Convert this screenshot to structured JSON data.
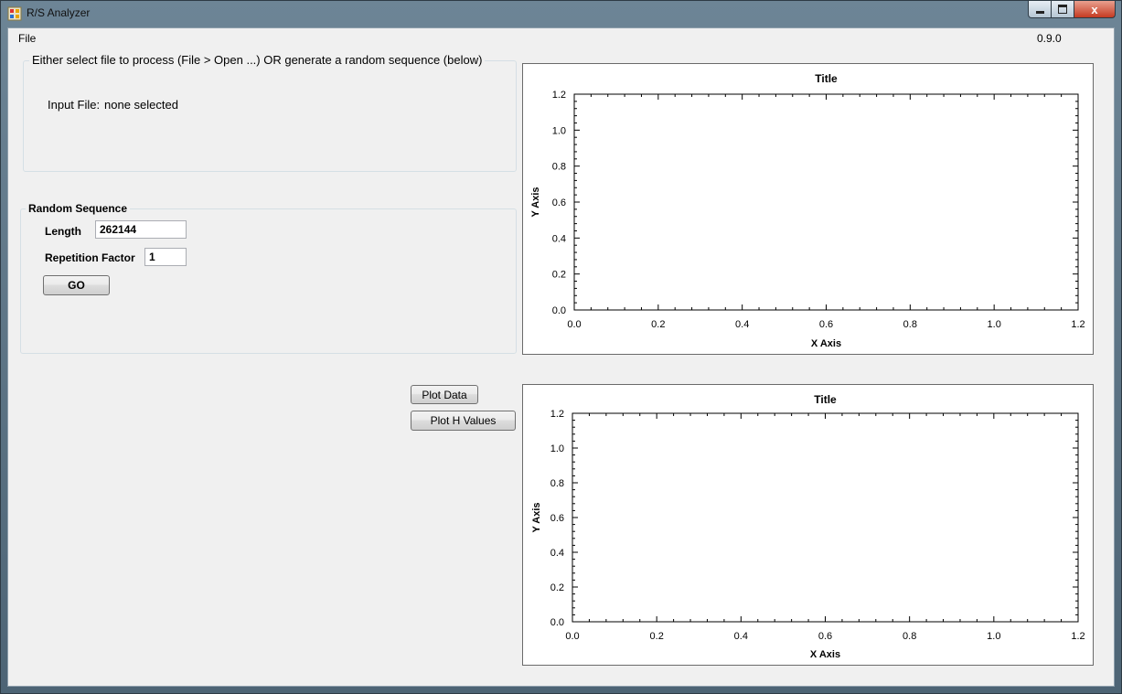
{
  "window": {
    "title": "R/S Analyzer",
    "close_glyph": "x"
  },
  "menu": {
    "file_label": "File",
    "version": "0.9.0"
  },
  "input_group": {
    "caption": "Either select file to process (File > Open ...) OR generate a random sequence (below)",
    "input_file_label": "Input File:",
    "input_file_value": "none selected"
  },
  "random_group": {
    "caption": "Random Sequence",
    "length_label": "Length",
    "length_value": "262144",
    "repetition_label": "Repetition Factor",
    "repetition_value": "1",
    "go_label": "GO"
  },
  "buttons": {
    "plot_data": "Plot Data",
    "plot_h_values": "Plot H Values"
  },
  "chart_data": [
    {
      "type": "line",
      "title": "Title",
      "xlabel": "X Axis",
      "ylabel": "Y Axis",
      "xlim": [
        0.0,
        1.2
      ],
      "ylim": [
        0.0,
        1.2
      ],
      "xticks": [
        "0.0",
        "0.2",
        "0.4",
        "0.6",
        "0.8",
        "1.0",
        "1.2"
      ],
      "yticks": [
        "0.0",
        "0.2",
        "0.4",
        "0.6",
        "0.8",
        "1.0",
        "1.2"
      ],
      "grid": false,
      "series": []
    },
    {
      "type": "line",
      "title": "Title",
      "xlabel": "X Axis",
      "ylabel": "Y Axis",
      "xlim": [
        0.0,
        1.2
      ],
      "ylim": [
        0.0,
        1.2
      ],
      "xticks": [
        "0.0",
        "0.2",
        "0.4",
        "0.6",
        "0.8",
        "1.0",
        "1.2"
      ],
      "yticks": [
        "0.0",
        "0.2",
        "0.4",
        "0.6",
        "0.8",
        "1.0",
        "1.2"
      ],
      "grid": false,
      "series": []
    }
  ]
}
